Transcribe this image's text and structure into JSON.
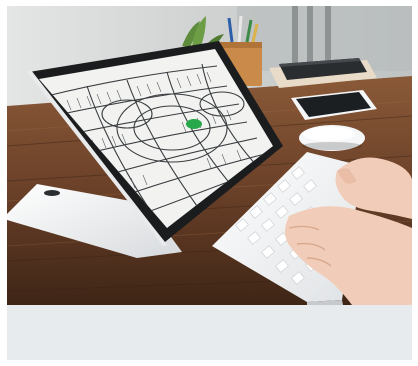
{
  "photo": {
    "alt": "",
    "colors": {
      "wall": "#d5d8d8",
      "table": "#7a4c2e",
      "table_dark": "#4a2c1a",
      "laptop": "#eef0f2",
      "screen_bg": "#f2f3f1",
      "map_lines": "#3a3d40",
      "highlight": "#27a84a",
      "keyboard": "#f4f5f6",
      "skin": "#f1cdb9",
      "footer": "#e7ebee"
    },
    "icons": [
      "laptop-icon",
      "keyboard-icon",
      "mouse-icon",
      "tablet-icon",
      "notebook-icon",
      "pencil-cup-icon",
      "plant-icon",
      "hand-icon"
    ]
  }
}
